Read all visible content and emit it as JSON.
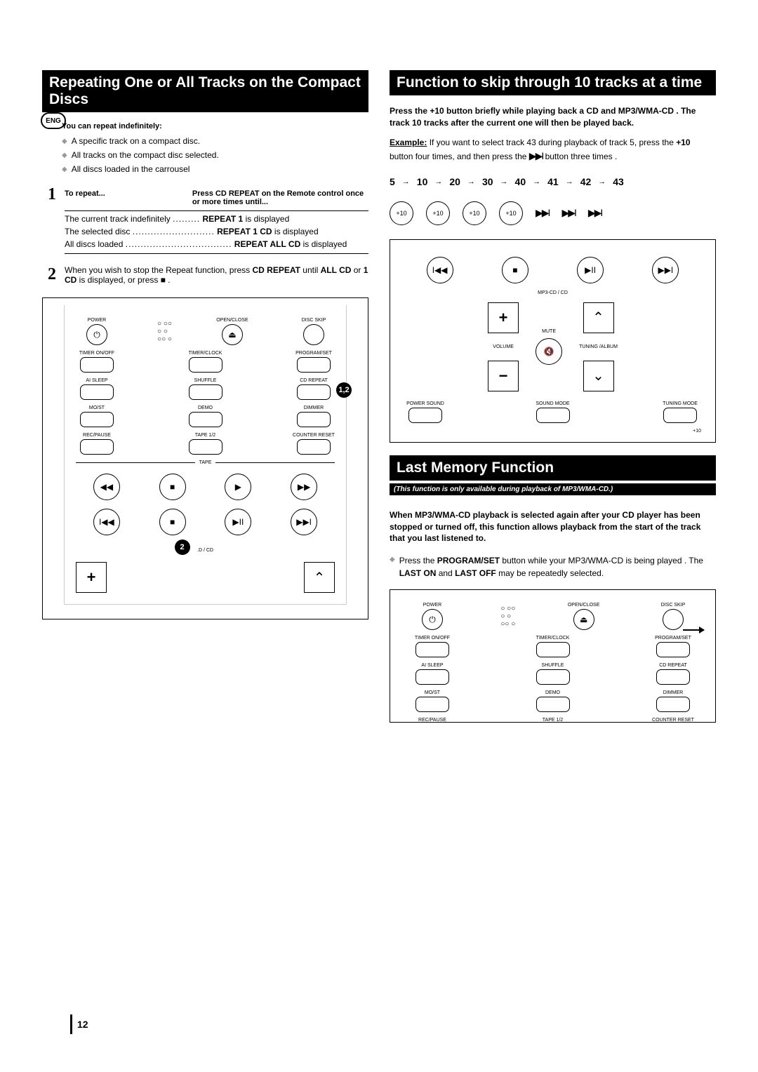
{
  "eng_badge": "ENG",
  "page_number": "12",
  "left": {
    "heading": "Repeating One or All Tracks on the Compact Discs",
    "intro_bold": "You can repeat indefinitely:",
    "bullets": [
      "A specific track on a compact disc.",
      "All tracks on the compact disc selected.",
      "All discs loaded in the carrousel"
    ],
    "step1": {
      "num": "1",
      "left_label": "To repeat...",
      "right_label": "Press CD REPEAT on the Remote control once or more times until...",
      "rows": [
        {
          "lead": "The current track indefinitely",
          "dots": ".........",
          "res_b": "REPEAT 1",
          "res_after": " is displayed"
        },
        {
          "lead": "The selected disc",
          "dots": "...........................",
          "res_b": "REPEAT 1 CD",
          "res_after": " is displayed"
        },
        {
          "lead": "All discs loaded",
          "dots": "...................................",
          "res_b": "REPEAT ALL CD",
          "res_after": " is displayed"
        }
      ]
    },
    "step2": {
      "num": "2",
      "text_a": "When you wish to stop the Repeat function, press ",
      "text_b": "CD REPEAT",
      "text_c": " until ",
      "text_d": "ALL CD",
      "text_e": " or ",
      "text_f": "1 CD",
      "text_g": " is displayed, or press ■ ."
    },
    "remote": {
      "row1": [
        "POWER",
        "OPEN/CLOSE",
        "DISC SKIP"
      ],
      "row2": [
        "TIMER ON/OFF",
        "TIMER/CLOCK",
        "PROGRAM/SET"
      ],
      "row3": [
        "AI SLEEP",
        "SHUFFLE",
        "CD REPEAT"
      ],
      "row4": [
        "MO/ST",
        "DEMO",
        "DIMMER"
      ],
      "row5": [
        "REC/PAUSE",
        "TAPE 1/2",
        "COUNTER RESET"
      ],
      "tape": "TAPE",
      "cd_label": ".D / CD",
      "badge12": "1,2",
      "badge2": "2"
    }
  },
  "right": {
    "heading1": "Function to skip through 10 tracks at a time",
    "intro_bold": "Press the +10 button briefly while playing back a CD and MP3/WMA-CD . The track 10 tracks after the current one will then be played back.",
    "example_label": "Example:",
    "example_text": " If you want to select track 43 during playback of track 5, press the ",
    "example_b2": "+10",
    "example_text2": " button four times, and then press the ",
    "example_text3": " button three times .",
    "seq": [
      "5",
      "10",
      "20",
      "30",
      "40",
      "41",
      "42",
      "43"
    ],
    "plus10": "+10",
    "remote_section": {
      "mp3cd": "MP3-CD / CD",
      "mute": "MUTE",
      "volume": "VOLUME",
      "tuning": "TUNING /ALBUM",
      "bottom": [
        "POWER SOUND",
        "SOUND MODE",
        "TUNING MODE"
      ],
      "plus10_label": "+10"
    },
    "heading2": "Last Memory Function",
    "heading2_sub": "(This function is only available during playback of MP3/WMA-CD.)",
    "lm_bold": "When MP3/WMA-CD playback is selected again after your CD player has been stopped or turned off, this function allows playback from the start of the track that you last listened to.",
    "lm_body_a": "Press the ",
    "lm_body_b": "PROGRAM/SET",
    "lm_body_c": " button while your MP3/WMA-CD is being played . The ",
    "lm_body_d": "LAST ON",
    "lm_body_e": " and ",
    "lm_body_f": "LAST OFF",
    "lm_body_g": " may be repeatedly selected.",
    "remote2": {
      "row1": [
        "POWER",
        "OPEN/CLOSE",
        "DISC SKIP"
      ],
      "row2": [
        "TIMER ON/OFF",
        "TIMER/CLOCK",
        "PROGRAM/SET"
      ],
      "row3": [
        "AI SLEEP",
        "SHUFFLE",
        "CD REPEAT"
      ],
      "row4": [
        "MO/ST",
        "DEMO",
        "DIMMER"
      ],
      "row5": [
        "REC/PAUSE",
        "TAPE 1/2",
        "COUNTER RESET"
      ]
    }
  }
}
